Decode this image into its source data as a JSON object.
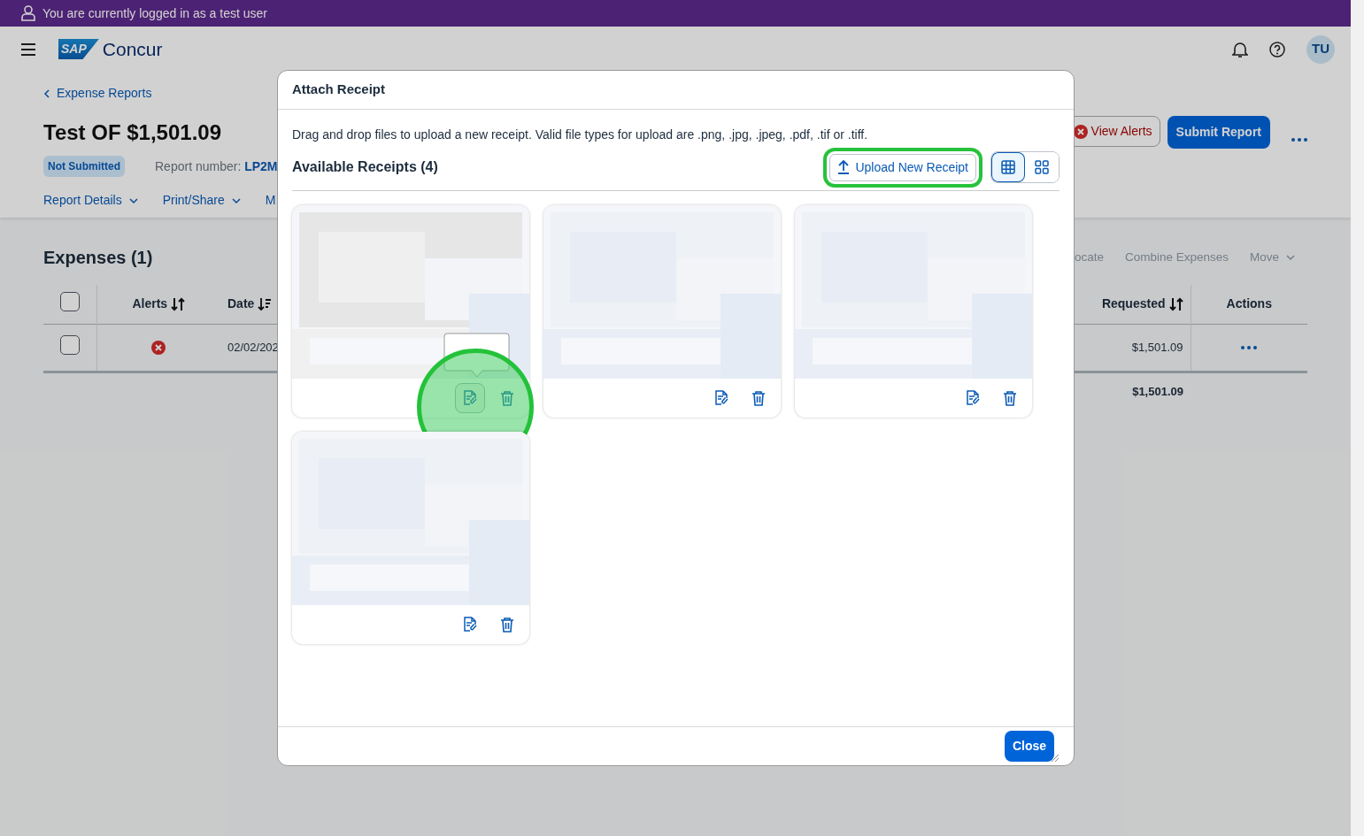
{
  "banner": {
    "text": "You are currently logged in as a test user"
  },
  "header": {
    "logo_badge": "SAP",
    "logo_text": "Concur",
    "avatar": "TU"
  },
  "report": {
    "back_link": "Expense Reports",
    "title": "Test OF $1,501.09",
    "status": "Not Submitted",
    "number_label": "Report number:",
    "number": "LP2M",
    "tabs": [
      {
        "label": "Report Details",
        "dropdown": true
      },
      {
        "label": "Print/Share",
        "dropdown": true
      },
      {
        "label": "M",
        "dropdown": false
      }
    ],
    "buttons": [
      {
        "kind": "alert",
        "label": "View Alerts"
      },
      {
        "kind": "primary",
        "label": "Submit Report"
      }
    ]
  },
  "expenses": {
    "title": "Expenses (1)",
    "toolbar": [
      {
        "label": "ocate",
        "disabled": true,
        "dropdown": false
      },
      {
        "label": "Combine Expenses",
        "disabled": true,
        "dropdown": false
      },
      {
        "label": "Move",
        "disabled": true,
        "dropdown": true
      }
    ],
    "columns": [
      {
        "kind": "checkbox",
        "checked": false
      },
      {
        "kind": "text",
        "label": "Alerts",
        "sortable": true,
        "sorted": false
      },
      {
        "kind": "text",
        "label": "Date",
        "sortable": true,
        "sorted": true
      },
      {
        "kind": "spacer"
      },
      {
        "kind": "text",
        "label": "Requested",
        "sortable": true,
        "sorted": false
      },
      {
        "kind": "text",
        "label": "Actions",
        "sortable": false
      }
    ],
    "rows": [
      {
        "checked": false,
        "alert": true,
        "date": "02/02/202",
        "requested": "$1,501.09"
      }
    ],
    "total": "$1,501.09"
  },
  "modal": {
    "title": "Attach Receipt",
    "instructions": "Drag and drop files to upload a new receipt. Valid file types for upload are .png, .jpg, .jpeg, .pdf, .tif or .tiff.",
    "heading": "Available Receipts (4)",
    "upload_button": {
      "label": "Upload New Receipt",
      "highlighted": true
    },
    "views": [
      {
        "kind": "table",
        "selected": true
      },
      {
        "kind": "tiles",
        "selected": false
      }
    ],
    "receipts": [
      {
        "kind": "picture",
        "tooltip": true,
        "attach_highlighted": true
      },
      {
        "kind": "picture",
        "tooltip": false,
        "attach_highlighted": false
      },
      {
        "kind": "picture",
        "tooltip": false,
        "attach_highlighted": false
      },
      {
        "kind": "picture",
        "tooltip": false,
        "attach_highlighted": false
      }
    ],
    "close_button": "Close"
  }
}
